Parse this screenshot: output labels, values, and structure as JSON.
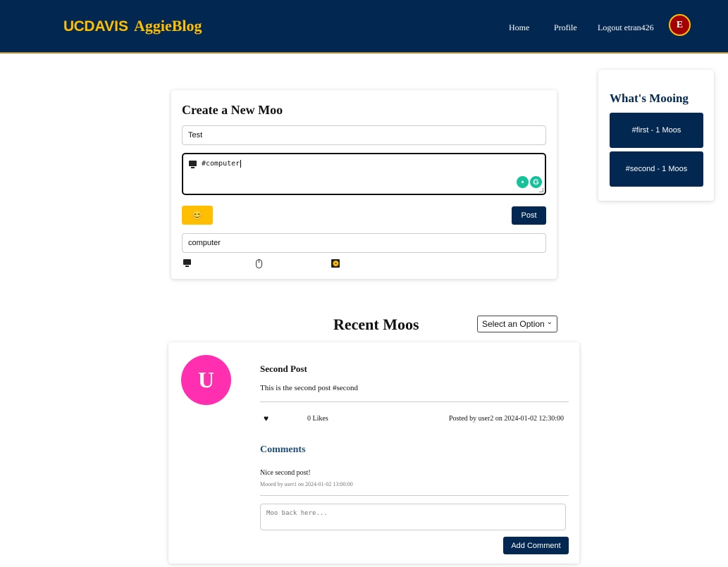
{
  "header": {
    "brand_uc": "UC",
    "brand_davis": "DAVIS",
    "brand_blog": "AggieBlog",
    "nav": {
      "home": "Home",
      "profile": "Profile",
      "logout": "Logout etran426"
    },
    "avatar_letter": "E"
  },
  "create": {
    "title": "Create a New Moo",
    "title_value": "Test",
    "content_value": "#computer",
    "content_emoji": "computer-icon",
    "emoji_button_icon": "😊",
    "post_label": "Post",
    "emoji_search_value": "computer",
    "emoji_results": [
      "computer-icon",
      "computer-mouse-icon",
      "computer-disk-icon"
    ]
  },
  "trending": {
    "title": "What's Mooing",
    "tags": [
      "#first - 1 Moos",
      "#second - 1 Moos"
    ]
  },
  "recent": {
    "title": "Recent Moos",
    "sort_value": "Select an Option"
  },
  "posts": [
    {
      "avatar_letter": "U",
      "avatar_color": "#ff2fb0",
      "title": "Second Post",
      "body": "This is the second post #second",
      "like_icon": "♥",
      "likes": "0 Likes",
      "posted_by": "Posted by user2 on 2024-01-02 12:30:00",
      "comments_title": "Comments",
      "comments": [
        {
          "text": "Nice second post!",
          "meta": "Mooed by user1 on 2024-01-02 13:00:00"
        }
      ],
      "comment_placeholder": "Moo back here...",
      "add_comment_label": "Add Comment"
    }
  ],
  "colors": {
    "navy": "#022851",
    "gold": "#ffbf00",
    "avatar_e": "#a30000"
  }
}
